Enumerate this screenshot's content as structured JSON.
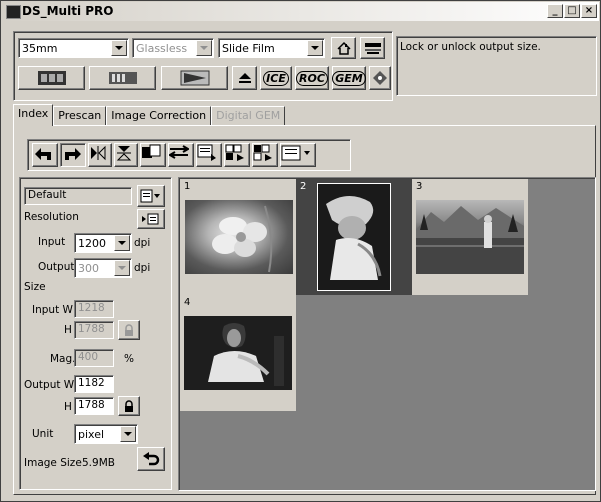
{
  "window": {
    "title": "DS_Multi PRO",
    "buttons": [
      "_",
      "□",
      "×"
    ]
  },
  "top": {
    "film_format": "35mm",
    "holder": "Glassless",
    "film_type": "Slide Film",
    "message": "Lock or unlock output size.",
    "action_labels": [
      "ICE",
      "ROC",
      "GEM"
    ]
  },
  "tabs": [
    {
      "label": "Index",
      "active": true
    },
    {
      "label": "Prescan",
      "active": false
    },
    {
      "label": "Image Correction",
      "active": false
    },
    {
      "label": "Digital GEM",
      "disabled": true
    }
  ],
  "settings": {
    "preset": "Default",
    "resolution_label": "Resolution",
    "input_label": "Input",
    "input_value": "1200",
    "input_unit": "dpi",
    "output_label": "Output",
    "output_value": "300",
    "output_unit": "dpi",
    "size_label": "Size",
    "input_w_label": "Input W",
    "input_w_value": "1218",
    "input_h_label": "H",
    "input_h_value": "1788",
    "mag_label": "Mag.",
    "mag_value": "400",
    "mag_unit": "%",
    "output_w_label": "Output W",
    "output_w_value": "1182",
    "output_h_label": "H",
    "output_h_value": "1788",
    "unit_label": "Unit",
    "unit_value": "pixel",
    "image_size_label": "Image Size",
    "image_size_value": "5.9MB"
  },
  "thumbnails": [
    {
      "num": "1",
      "selected": false
    },
    {
      "num": "2",
      "selected": true
    },
    {
      "num": "3",
      "selected": false
    },
    {
      "num": "4",
      "selected": false
    }
  ]
}
